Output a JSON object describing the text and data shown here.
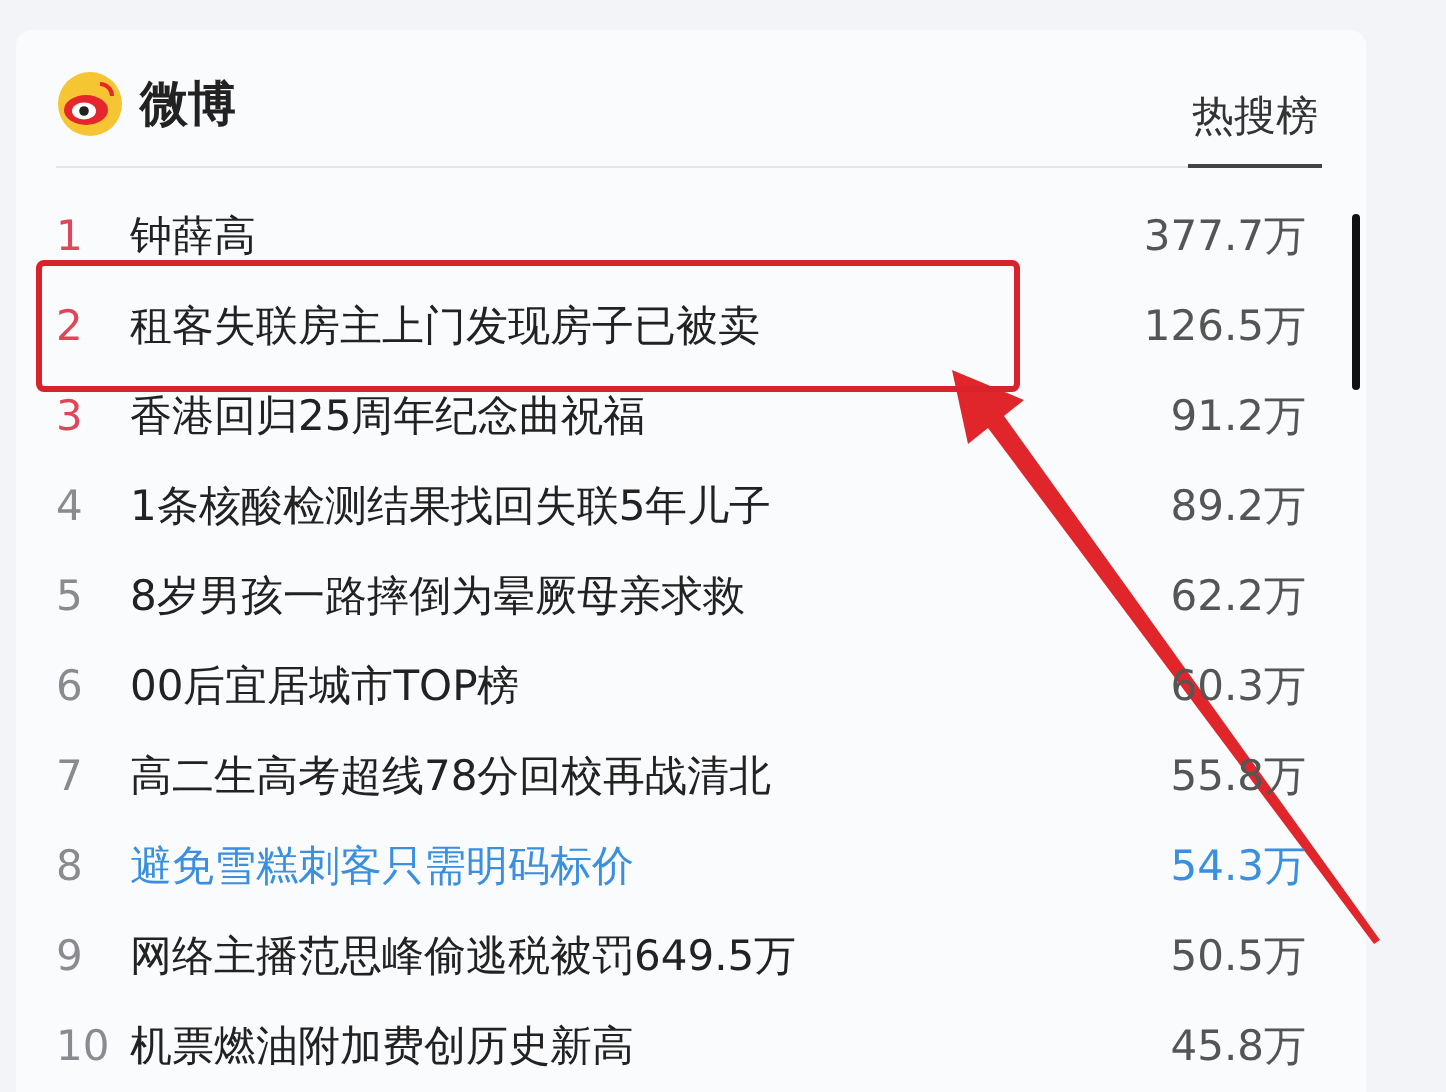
{
  "header": {
    "brand": "微博",
    "tab": {
      "label": "热搜榜",
      "selected": true
    }
  },
  "items": [
    {
      "rank": "1",
      "title": "钟薛高",
      "count": "377.7万",
      "color": "#e0465a",
      "highlighted": false,
      "framed": false
    },
    {
      "rank": "2",
      "title": "租客失联房主上门发现房子已被卖",
      "count": "126.5万",
      "color": "#e0465a",
      "highlighted": false,
      "framed": true
    },
    {
      "rank": "3",
      "title": "香港回归25周年纪念曲祝福",
      "count": "91.2万",
      "color": "#e0465a",
      "highlighted": false,
      "framed": false
    },
    {
      "rank": "4",
      "title": "1条核酸检测结果找回失联5年儿子",
      "count": "89.2万",
      "color": "#8a8a90",
      "highlighted": false,
      "framed": false
    },
    {
      "rank": "5",
      "title": "8岁男孩一路摔倒为晕厥母亲求救",
      "count": "62.2万",
      "color": "#8a8a90",
      "highlighted": false,
      "framed": false
    },
    {
      "rank": "6",
      "title": "00后宜居城市TOP榜",
      "count": "60.3万",
      "color": "#8a8a90",
      "highlighted": false,
      "framed": false
    },
    {
      "rank": "7",
      "title": "高二生高考超线78分回校再战清北",
      "count": "55.8万",
      "color": "#8a8a90",
      "highlighted": false,
      "framed": false
    },
    {
      "rank": "8",
      "title": "避免雪糕刺客只需明码标价",
      "count": "54.3万",
      "color": "#8a8a90",
      "highlighted": true,
      "framed": false
    },
    {
      "rank": "9",
      "title": "网络主播范思峰偷逃税被罚649.5万",
      "count": "50.5万",
      "color": "#8a8a90",
      "highlighted": false,
      "framed": false
    },
    {
      "rank": "10",
      "title": "机票燃油附加费创历史新高",
      "count": "45.8万",
      "color": "#8a8a90",
      "highlighted": false,
      "framed": false
    }
  ]
}
